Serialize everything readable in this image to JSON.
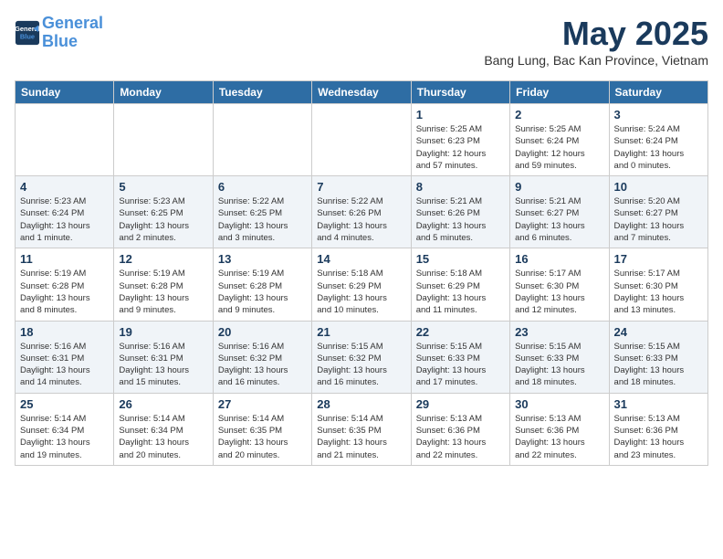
{
  "header": {
    "logo_line1": "General",
    "logo_line2": "Blue",
    "month": "May 2025",
    "location": "Bang Lung, Bac Kan Province, Vietnam"
  },
  "weekdays": [
    "Sunday",
    "Monday",
    "Tuesday",
    "Wednesday",
    "Thursday",
    "Friday",
    "Saturday"
  ],
  "weeks": [
    [
      {
        "day": "",
        "info": ""
      },
      {
        "day": "",
        "info": ""
      },
      {
        "day": "",
        "info": ""
      },
      {
        "day": "",
        "info": ""
      },
      {
        "day": "1",
        "info": "Sunrise: 5:25 AM\nSunset: 6:23 PM\nDaylight: 12 hours\nand 57 minutes."
      },
      {
        "day": "2",
        "info": "Sunrise: 5:25 AM\nSunset: 6:24 PM\nDaylight: 12 hours\nand 59 minutes."
      },
      {
        "day": "3",
        "info": "Sunrise: 5:24 AM\nSunset: 6:24 PM\nDaylight: 13 hours\nand 0 minutes."
      }
    ],
    [
      {
        "day": "4",
        "info": "Sunrise: 5:23 AM\nSunset: 6:24 PM\nDaylight: 13 hours\nand 1 minute."
      },
      {
        "day": "5",
        "info": "Sunrise: 5:23 AM\nSunset: 6:25 PM\nDaylight: 13 hours\nand 2 minutes."
      },
      {
        "day": "6",
        "info": "Sunrise: 5:22 AM\nSunset: 6:25 PM\nDaylight: 13 hours\nand 3 minutes."
      },
      {
        "day": "7",
        "info": "Sunrise: 5:22 AM\nSunset: 6:26 PM\nDaylight: 13 hours\nand 4 minutes."
      },
      {
        "day": "8",
        "info": "Sunrise: 5:21 AM\nSunset: 6:26 PM\nDaylight: 13 hours\nand 5 minutes."
      },
      {
        "day": "9",
        "info": "Sunrise: 5:21 AM\nSunset: 6:27 PM\nDaylight: 13 hours\nand 6 minutes."
      },
      {
        "day": "10",
        "info": "Sunrise: 5:20 AM\nSunset: 6:27 PM\nDaylight: 13 hours\nand 7 minutes."
      }
    ],
    [
      {
        "day": "11",
        "info": "Sunrise: 5:19 AM\nSunset: 6:28 PM\nDaylight: 13 hours\nand 8 minutes."
      },
      {
        "day": "12",
        "info": "Sunrise: 5:19 AM\nSunset: 6:28 PM\nDaylight: 13 hours\nand 9 minutes."
      },
      {
        "day": "13",
        "info": "Sunrise: 5:19 AM\nSunset: 6:28 PM\nDaylight: 13 hours\nand 9 minutes."
      },
      {
        "day": "14",
        "info": "Sunrise: 5:18 AM\nSunset: 6:29 PM\nDaylight: 13 hours\nand 10 minutes."
      },
      {
        "day": "15",
        "info": "Sunrise: 5:18 AM\nSunset: 6:29 PM\nDaylight: 13 hours\nand 11 minutes."
      },
      {
        "day": "16",
        "info": "Sunrise: 5:17 AM\nSunset: 6:30 PM\nDaylight: 13 hours\nand 12 minutes."
      },
      {
        "day": "17",
        "info": "Sunrise: 5:17 AM\nSunset: 6:30 PM\nDaylight: 13 hours\nand 13 minutes."
      }
    ],
    [
      {
        "day": "18",
        "info": "Sunrise: 5:16 AM\nSunset: 6:31 PM\nDaylight: 13 hours\nand 14 minutes."
      },
      {
        "day": "19",
        "info": "Sunrise: 5:16 AM\nSunset: 6:31 PM\nDaylight: 13 hours\nand 15 minutes."
      },
      {
        "day": "20",
        "info": "Sunrise: 5:16 AM\nSunset: 6:32 PM\nDaylight: 13 hours\nand 16 minutes."
      },
      {
        "day": "21",
        "info": "Sunrise: 5:15 AM\nSunset: 6:32 PM\nDaylight: 13 hours\nand 16 minutes."
      },
      {
        "day": "22",
        "info": "Sunrise: 5:15 AM\nSunset: 6:33 PM\nDaylight: 13 hours\nand 17 minutes."
      },
      {
        "day": "23",
        "info": "Sunrise: 5:15 AM\nSunset: 6:33 PM\nDaylight: 13 hours\nand 18 minutes."
      },
      {
        "day": "24",
        "info": "Sunrise: 5:15 AM\nSunset: 6:33 PM\nDaylight: 13 hours\nand 18 minutes."
      }
    ],
    [
      {
        "day": "25",
        "info": "Sunrise: 5:14 AM\nSunset: 6:34 PM\nDaylight: 13 hours\nand 19 minutes."
      },
      {
        "day": "26",
        "info": "Sunrise: 5:14 AM\nSunset: 6:34 PM\nDaylight: 13 hours\nand 20 minutes."
      },
      {
        "day": "27",
        "info": "Sunrise: 5:14 AM\nSunset: 6:35 PM\nDaylight: 13 hours\nand 20 minutes."
      },
      {
        "day": "28",
        "info": "Sunrise: 5:14 AM\nSunset: 6:35 PM\nDaylight: 13 hours\nand 21 minutes."
      },
      {
        "day": "29",
        "info": "Sunrise: 5:13 AM\nSunset: 6:36 PM\nDaylight: 13 hours\nand 22 minutes."
      },
      {
        "day": "30",
        "info": "Sunrise: 5:13 AM\nSunset: 6:36 PM\nDaylight: 13 hours\nand 22 minutes."
      },
      {
        "day": "31",
        "info": "Sunrise: 5:13 AM\nSunset: 6:36 PM\nDaylight: 13 hours\nand 23 minutes."
      }
    ]
  ]
}
